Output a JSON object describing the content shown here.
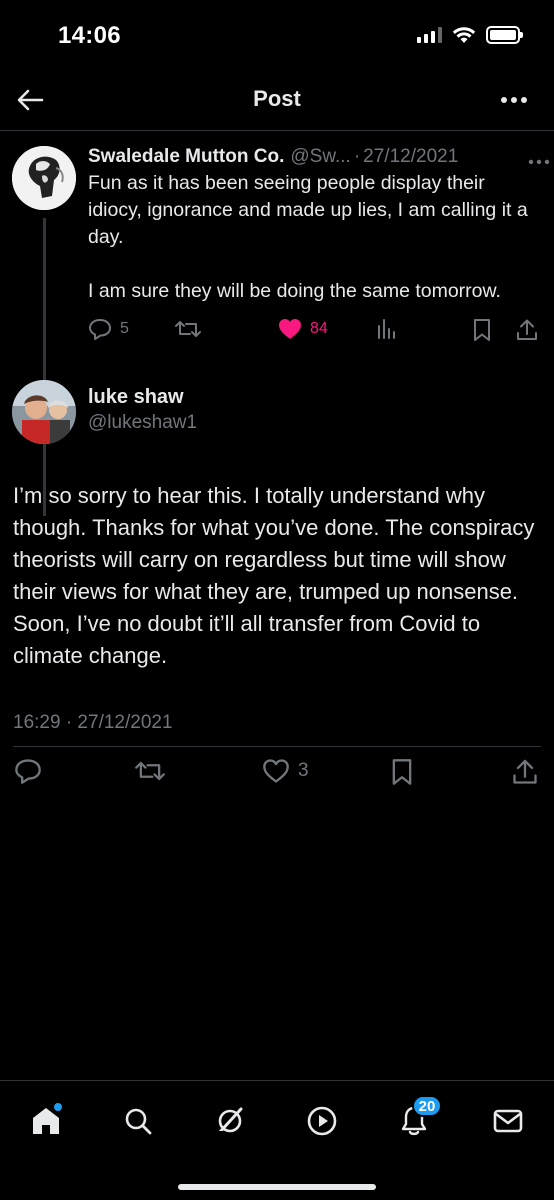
{
  "status_bar": {
    "time": "14:06"
  },
  "header": {
    "title": "Post"
  },
  "parent_post": {
    "author_name": "Swaledale Mutton Co.",
    "author_handle": "@Sw...",
    "separator": "·",
    "date": "27/12/2021",
    "text": "Fun as it has been seeing people display their idiocy, ignorance and made up lies, I am calling it a day.\n\nI am sure they will be doing the same tomorrow.",
    "reply_count": "5",
    "like_count": "84",
    "like_color": "#f91880"
  },
  "reply_post": {
    "author_name": "luke shaw",
    "author_handle": "@lukeshaw1",
    "text": "I’m so sorry to hear this. I totally understand why though. Thanks for what you’ve done. The conspiracy theorists will carry on regardless but time will show their views for what they are, trumped up nonsense. Soon, I’ve no doubt it’ll all transfer from Covid to climate change.",
    "timestamp": "16:29 · 27/12/2021",
    "like_count": "3"
  },
  "tabbar": {
    "notifications_badge": "20",
    "accent_color": "#1d9bf0"
  }
}
